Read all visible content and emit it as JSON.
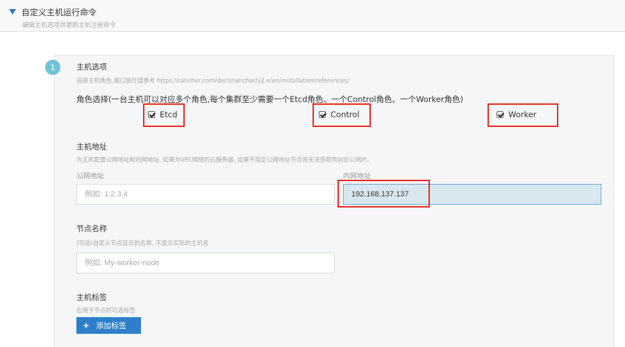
{
  "header": {
    "title": "自定义主机运行命令",
    "subtitle": "编辑主机选项并更新主机注册命令"
  },
  "step": {
    "number": "1",
    "title": "主机选项",
    "help": "选择主机角色,端口放行请参考 https://rancher.com/docs/rancher/v2.x/en/installation/references/"
  },
  "roles": {
    "label": "角色选择(一台主机可以对应多个角色,每个集群至少需要一个Etcd角色、一个Control角色、一个Worker角色)",
    "items": [
      {
        "label": "Etcd",
        "checked": true
      },
      {
        "label": "Control",
        "checked": true
      },
      {
        "label": "Worker",
        "checked": true
      }
    ]
  },
  "address": {
    "title": "主机地址",
    "help": "为主机配置公网地址和内网地址, 如果为VPC网络的云服务器, 如果不指定公网地址节点将无法获取到对应公网IP。",
    "public_label": "公网地址",
    "public_placeholder": "例如: 1.2.3.4",
    "private_label": "内网地址",
    "private_value": "192.168.137.137"
  },
  "node_name": {
    "title": "节点名称",
    "help": "(可选)自定义节点显示的名称, 不显示实际的主机名",
    "placeholder": "例如: My-worker-node"
  },
  "labels": {
    "title": "主机标签",
    "help": "应用于节点的可选标签",
    "add_button_icon": "+",
    "add_button": "添加标签"
  },
  "colors": {
    "accent": "#2d7fcb",
    "highlight": "#e8281e",
    "step_badge": "#72c3d6"
  }
}
